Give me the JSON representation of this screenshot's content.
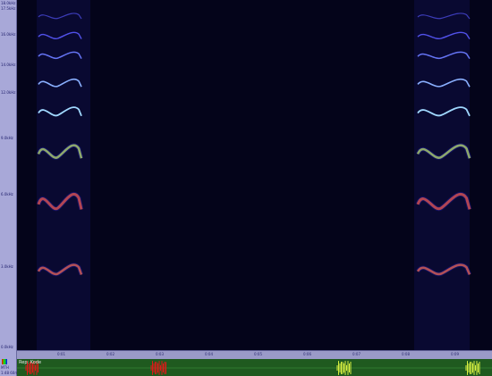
{
  "y_axis": {
    "labels": [
      "18.0kHz",
      "17.5kHz",
      "16.0kHz",
      "14.0kHz",
      "12.0kHz",
      "9.0kHz",
      "6.0kHz",
      "3.0kHz",
      "0.0kHz"
    ]
  },
  "time_axis": {
    "ticks": [
      "0:01",
      "0:02",
      "0:03",
      "0:04",
      "0:05",
      "0:06",
      "0:07",
      "0:08",
      "0:09"
    ]
  },
  "track": {
    "name": "Rep: Kode"
  },
  "left_panel": {
    "labels": [
      "MTH",
      "1:48 60ms"
    ]
  },
  "colors": {
    "spectro_bg": "#04041a",
    "wave_bg": "#1f5a1f",
    "wave_red": "#e01818",
    "wave_yellow": "#d8f040"
  }
}
